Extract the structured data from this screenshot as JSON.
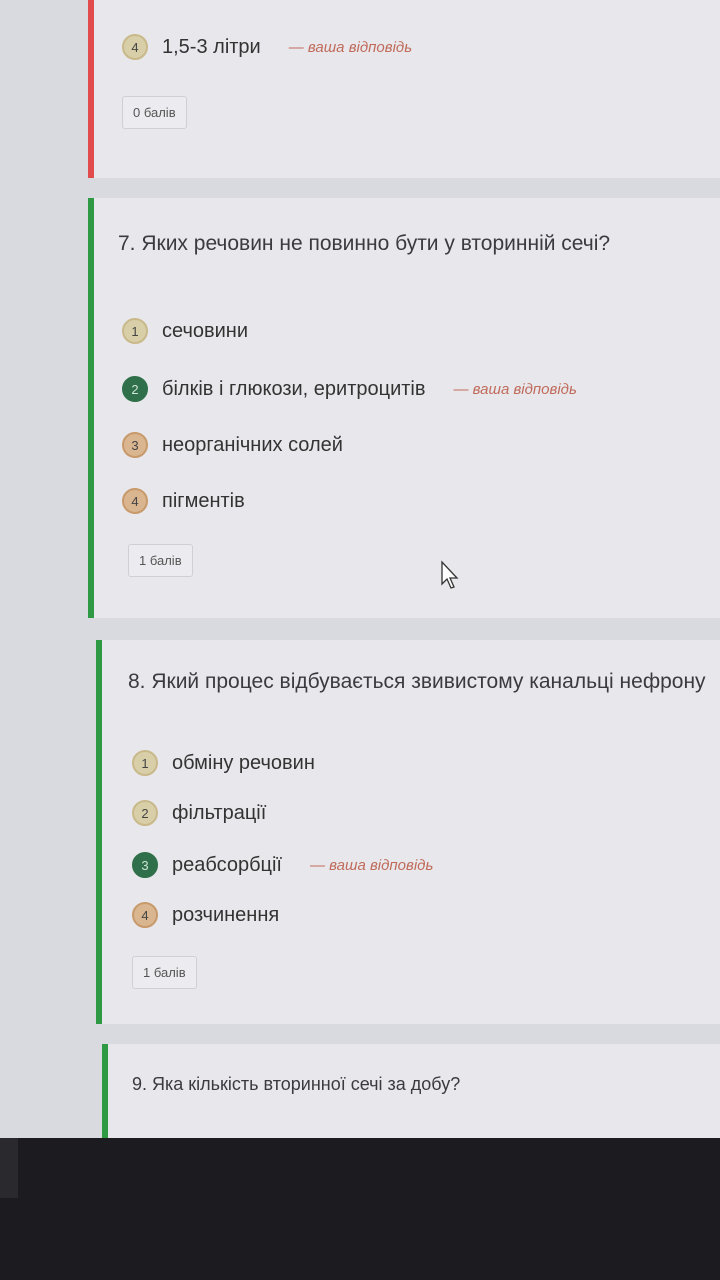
{
  "colors": {
    "incorrect_stripe": "#e14b4b",
    "correct_stripe": "#2e9a44",
    "selected_badge": "#2f6f49",
    "your_answer_text": "#c06a5a"
  },
  "q6_partial": {
    "answer": {
      "number": "4",
      "text": "1,5-3 літри",
      "your_answer": "— ваша відповідь"
    },
    "points": "0 балів"
  },
  "q7": {
    "title": "7. Яких речовин не повинно бути у вторинній сечі?",
    "answers": [
      {
        "number": "1",
        "text": "сечовини"
      },
      {
        "number": "2",
        "text": "білків і глюкози, еритроцитів",
        "your_answer": "— ваша відповідь"
      },
      {
        "number": "3",
        "text": "неорганічних солей"
      },
      {
        "number": "4",
        "text": "пігментів"
      }
    ],
    "points": "1 балів"
  },
  "q8": {
    "title": "8. Який процес відбувається звивистому канальці нефрону",
    "answers": [
      {
        "number": "1",
        "text": "обміну речовин"
      },
      {
        "number": "2",
        "text": "фільтрації"
      },
      {
        "number": "3",
        "text": "реабсорбції",
        "your_answer": "— ваша відповідь"
      },
      {
        "number": "4",
        "text": "розчинення"
      }
    ],
    "points": "1 балів"
  },
  "q9": {
    "title": "9. Яка кількість вторинної сечі за добу?"
  },
  "icons": {
    "cursor": "mouse-pointer-icon"
  }
}
